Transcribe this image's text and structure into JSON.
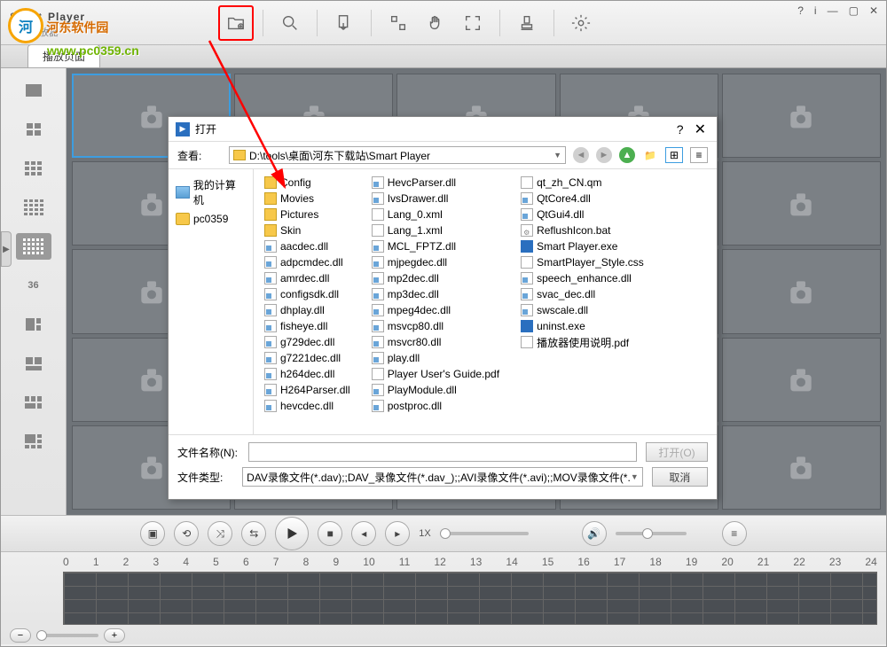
{
  "app": {
    "title_a": "Smart",
    "title_b": "Player",
    "subtitle": "视频播放器"
  },
  "watermark": {
    "name": "河东软件园",
    "url": "www.pc0359.cn"
  },
  "win": {
    "help": "?",
    "info": "i",
    "min": "—",
    "restore": "▢",
    "close": "✕"
  },
  "tab": {
    "label": "播放页面"
  },
  "layouts": {
    "l36": "36"
  },
  "playback": {
    "speed": "1X"
  },
  "timeline": {
    "hours": [
      "0",
      "1",
      "2",
      "3",
      "4",
      "5",
      "6",
      "7",
      "8",
      "9",
      "10",
      "11",
      "12",
      "13",
      "14",
      "15",
      "16",
      "17",
      "18",
      "19",
      "20",
      "21",
      "22",
      "23",
      "24"
    ]
  },
  "dialog": {
    "title": "打开",
    "look_in_label": "查看:",
    "path": "D:\\tools\\桌面\\河东下载站\\Smart Player",
    "places": {
      "computer": "我的计算机",
      "user": "pc0359"
    },
    "filename_label": "文件名称(N):",
    "filetype_label": "文件类型:",
    "filetype_value": "DAV录像文件(*.dav);;DAV_录像文件(*.dav_);;AVI录像文件(*.avi);;MOV录像文件(*.",
    "open_btn": "打开(O)",
    "cancel_btn": "取消",
    "files_col1": [
      {
        "ic": "folder",
        "name": "Config"
      },
      {
        "ic": "folder",
        "name": "Movies"
      },
      {
        "ic": "folder",
        "name": "Pictures"
      },
      {
        "ic": "folder",
        "name": "Skin"
      },
      {
        "ic": "dll",
        "name": "aacdec.dll"
      },
      {
        "ic": "dll",
        "name": "adpcmdec.dll"
      },
      {
        "ic": "dll",
        "name": "amrdec.dll"
      },
      {
        "ic": "dll",
        "name": "configsdk.dll"
      },
      {
        "ic": "dll",
        "name": "dhplay.dll"
      },
      {
        "ic": "dll",
        "name": "fisheye.dll"
      },
      {
        "ic": "dll",
        "name": "g729dec.dll"
      },
      {
        "ic": "dll",
        "name": "g7221dec.dll"
      },
      {
        "ic": "dll",
        "name": "h264dec.dll"
      },
      {
        "ic": "dll",
        "name": "H264Parser.dll"
      },
      {
        "ic": "dll",
        "name": "hevcdec.dll"
      }
    ],
    "files_col2": [
      {
        "ic": "dll",
        "name": "HevcParser.dll"
      },
      {
        "ic": "dll",
        "name": "IvsDrawer.dll"
      },
      {
        "ic": "xml",
        "name": "Lang_0.xml"
      },
      {
        "ic": "xml",
        "name": "Lang_1.xml"
      },
      {
        "ic": "dll",
        "name": "MCL_FPTZ.dll"
      },
      {
        "ic": "dll",
        "name": "mjpegdec.dll"
      },
      {
        "ic": "dll",
        "name": "mp2dec.dll"
      },
      {
        "ic": "dll",
        "name": "mp3dec.dll"
      },
      {
        "ic": "dll",
        "name": "mpeg4dec.dll"
      },
      {
        "ic": "dll",
        "name": "msvcp80.dll"
      },
      {
        "ic": "dll",
        "name": "msvcr80.dll"
      },
      {
        "ic": "dll",
        "name": "play.dll"
      },
      {
        "ic": "pdf",
        "name": "Player User's Guide.pdf"
      },
      {
        "ic": "dll",
        "name": "PlayModule.dll"
      },
      {
        "ic": "dll",
        "name": "postproc.dll"
      }
    ],
    "files_col3": [
      {
        "ic": "qm",
        "name": "qt_zh_CN.qm"
      },
      {
        "ic": "dll",
        "name": "QtCore4.dll"
      },
      {
        "ic": "dll",
        "name": "QtGui4.dll"
      },
      {
        "ic": "bat",
        "name": "ReflushIcon.bat"
      },
      {
        "ic": "exe",
        "name": "Smart Player.exe"
      },
      {
        "ic": "css",
        "name": "SmartPlayer_Style.css"
      },
      {
        "ic": "dll",
        "name": "speech_enhance.dll"
      },
      {
        "ic": "dll",
        "name": "svac_dec.dll"
      },
      {
        "ic": "dll",
        "name": "swscale.dll"
      },
      {
        "ic": "exe",
        "name": "uninst.exe"
      },
      {
        "ic": "pdf",
        "name": "播放器使用说明.pdf"
      }
    ]
  }
}
